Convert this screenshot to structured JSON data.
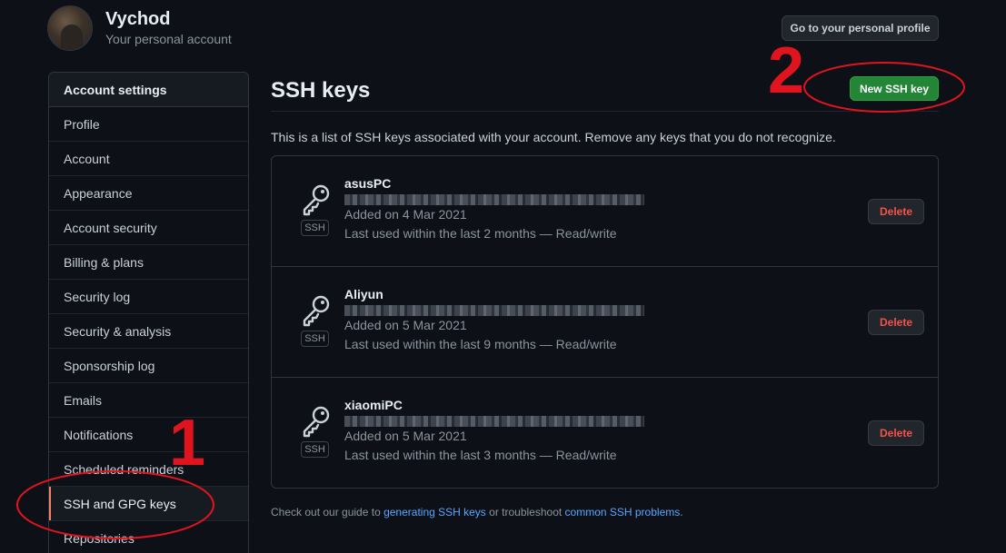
{
  "user": {
    "name": "Vychod",
    "subtitle": "Your personal account",
    "profile_button": "Go to your personal profile"
  },
  "sidebar": {
    "heading": "Account settings",
    "items": [
      {
        "label": "Profile"
      },
      {
        "label": "Account"
      },
      {
        "label": "Appearance"
      },
      {
        "label": "Account security"
      },
      {
        "label": "Billing & plans"
      },
      {
        "label": "Security log"
      },
      {
        "label": "Security & analysis"
      },
      {
        "label": "Sponsorship log"
      },
      {
        "label": "Emails"
      },
      {
        "label": "Notifications"
      },
      {
        "label": "Scheduled reminders"
      },
      {
        "label": "SSH and GPG keys",
        "active": true
      },
      {
        "label": "Repositories"
      }
    ]
  },
  "main": {
    "title": "SSH keys",
    "new_key_button": "New SSH key",
    "intro": "This is a list of SSH keys associated with your account. Remove any keys that you do not recognize.",
    "keys": [
      {
        "title": "asusPC",
        "badge": "SSH",
        "added": "Added on 4 Mar 2021",
        "last_used": "Last used within the last 2 months — Read/write",
        "delete_label": "Delete"
      },
      {
        "title": "Aliyun",
        "badge": "SSH",
        "added": "Added on 5 Mar 2021",
        "last_used": "Last used within the last 9 months — Read/write",
        "delete_label": "Delete"
      },
      {
        "title": "xiaomiPC",
        "badge": "SSH",
        "added": "Added on 5 Mar 2021",
        "last_used": "Last used within the last 3 months — Read/write",
        "delete_label": "Delete"
      }
    ],
    "footer": {
      "prefix": "Check out our guide to ",
      "link1": "generating SSH keys",
      "middle": " or troubleshoot ",
      "link2": "common SSH problems",
      "suffix": "."
    }
  },
  "annotations": {
    "marker1": "1",
    "marker2": "2",
    "color": "#e0141e"
  },
  "icons": {
    "key": "key-icon",
    "avatar": "user-avatar"
  }
}
